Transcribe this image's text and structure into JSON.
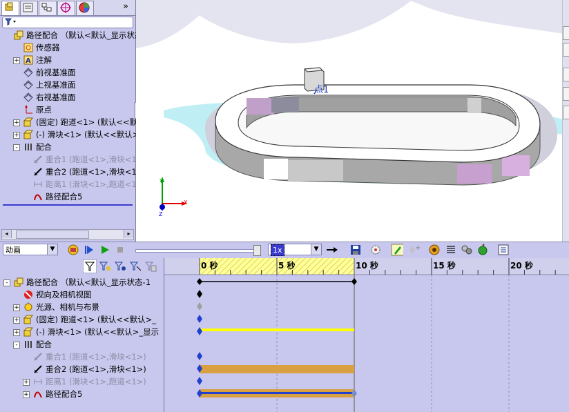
{
  "colors": {
    "panel": "#c8c8ee",
    "accent_blue": "#3a3ad0",
    "key_yellow": "#ffff00",
    "bar_orange": "#d8a040",
    "time_fill": "#ffff99"
  },
  "feature_tree": {
    "tabs": [
      "feature-manager-icon",
      "property-manager-icon",
      "configuration-manager-icon",
      "dimxpert-icon",
      "display-manager-icon"
    ],
    "more": "»",
    "items": [
      {
        "label": "路径配合  （默认<默认_显示状态",
        "icon": "assembly-icon",
        "expander": "",
        "level": 0
      },
      {
        "label": "传感器",
        "icon": "sensor-icon",
        "expander": "",
        "level": 1
      },
      {
        "label": "注解",
        "icon": "annotation-icon",
        "expander": "+",
        "level": 1
      },
      {
        "label": "前视基准面",
        "icon": "plane-icon",
        "expander": "",
        "level": 1
      },
      {
        "label": "上视基准面",
        "icon": "plane-icon",
        "expander": "",
        "level": 1
      },
      {
        "label": "右视基准面",
        "icon": "plane-icon",
        "expander": "",
        "level": 1
      },
      {
        "label": "原点",
        "icon": "origin-icon",
        "expander": "",
        "level": 1
      },
      {
        "label": "(固定) 跑道<1>  (默认<<默认",
        "icon": "part-icon",
        "expander": "+",
        "level": 1
      },
      {
        "label": "(-) 滑块<1>  (默认<<默认>_",
        "icon": "part-icon",
        "expander": "+",
        "level": 1
      },
      {
        "label": "配合",
        "icon": "mates-icon",
        "expander": "-",
        "level": 1
      },
      {
        "label": "重合1  (跑道<1>,滑块<1>",
        "icon": "coincident-icon",
        "expander": "",
        "level": 2,
        "dim": true
      },
      {
        "label": "重合2  (跑道<1>,滑块<1>",
        "icon": "coincident-icon",
        "expander": "",
        "level": 2,
        "dim": false
      },
      {
        "label": "距离1  (滑块<1>,跑道<1>",
        "icon": "distance-icon",
        "expander": "",
        "level": 2,
        "dim": true
      },
      {
        "label": "路径配合5",
        "icon": "path-mate-icon",
        "expander": "",
        "level": 2,
        "dim": false
      }
    ]
  },
  "viewport": {
    "point_label": "点1",
    "triad": {
      "x": "X",
      "y": "Y",
      "z": "Z"
    }
  },
  "anim_toolbar": {
    "study_type": "动画",
    "speed": "1x",
    "progress": 1.0
  },
  "timeline": {
    "ticks": [
      "0 秒",
      "5 秒",
      "10 秒",
      "15 秒",
      "20 秒"
    ],
    "tree": [
      {
        "label": "路径配合  （默认<默认_显示状态-1",
        "icon": "assembly-icon",
        "expander": "-",
        "level": 0
      },
      {
        "label": "视向及相机视图",
        "icon": "camera-view-icon",
        "expander": "",
        "level": 1
      },
      {
        "label": "光源、相机与布景",
        "icon": "lights-icon",
        "expander": "+",
        "level": 1
      },
      {
        "label": "(固定) 跑道<1>  (默认<<默认>_",
        "icon": "part-icon",
        "expander": "+",
        "level": 1
      },
      {
        "label": "(-) 滑块<1>  (默认<<默认>_显示",
        "icon": "part-icon",
        "expander": "+",
        "level": 1
      },
      {
        "label": "配合",
        "icon": "mates-icon",
        "expander": "-",
        "level": 1
      },
      {
        "label": "重合1  (跑道<1>,滑块<1>)",
        "icon": "coincident-icon",
        "expander": "",
        "level": 2,
        "dim": true
      },
      {
        "label": "重合2  (跑道<1>,滑块<1>)",
        "icon": "coincident-icon",
        "expander": "",
        "level": 2,
        "dim": false
      },
      {
        "label": "距离1  (滑块<1>,跑道<1>)",
        "icon": "distance-icon",
        "expander": "+",
        "level": 2,
        "dim": true
      },
      {
        "label": "路径配合5",
        "icon": "path-mate-icon",
        "expander": "+",
        "level": 2,
        "dim": false
      }
    ],
    "filters": [
      "filter-icon",
      "filter-animated-icon",
      "filter-driving-icon",
      "filter-selected-icon",
      "filter-results-icon"
    ]
  }
}
